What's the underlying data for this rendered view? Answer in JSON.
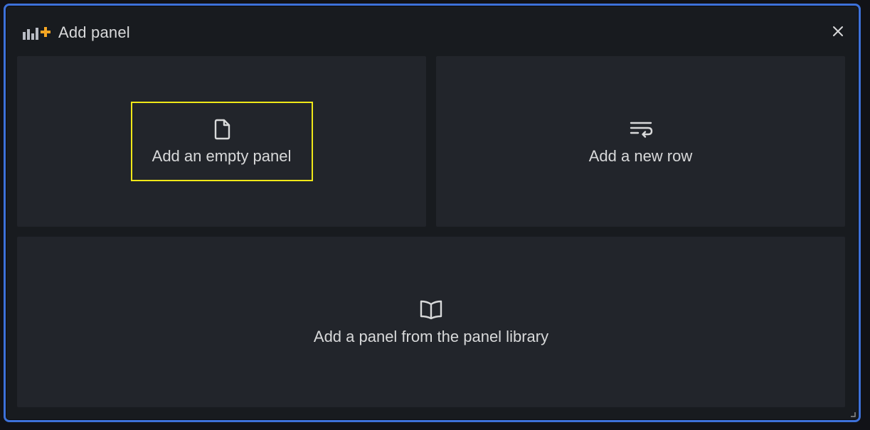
{
  "dialog": {
    "title": "Add panel",
    "title_icon": "add-panel-icon",
    "close_icon": "close-icon",
    "accent_color": "#f5a623",
    "border_color": "#3d71d9"
  },
  "cards": {
    "empty_panel": {
      "label": "Add an empty panel",
      "icon": "file-icon"
    },
    "new_row": {
      "label": "Add a new row",
      "icon": "row-wrap-icon"
    },
    "library_panel": {
      "label": "Add a panel from the panel library",
      "icon": "book-icon"
    }
  },
  "highlight_color": "#f0e818"
}
